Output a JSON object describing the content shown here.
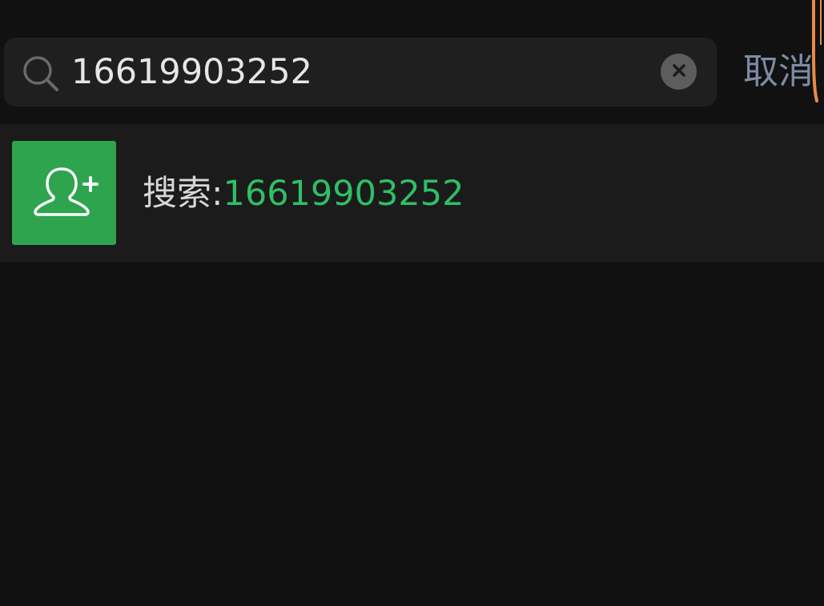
{
  "search": {
    "value": "16619903252",
    "cancel_label": "取消"
  },
  "result": {
    "prefix": "搜索:",
    "query": "16619903252"
  },
  "colors": {
    "background": "#111111",
    "search_box": "#1f1f1f",
    "row": "#1b1b1b",
    "accent_green": "#2fbf66",
    "tile_green": "#2ea44f",
    "cancel_blue": "#7d8ca5"
  },
  "icons": {
    "search": "search-icon",
    "clear": "clear-icon",
    "add_friend": "add-friend-icon"
  }
}
